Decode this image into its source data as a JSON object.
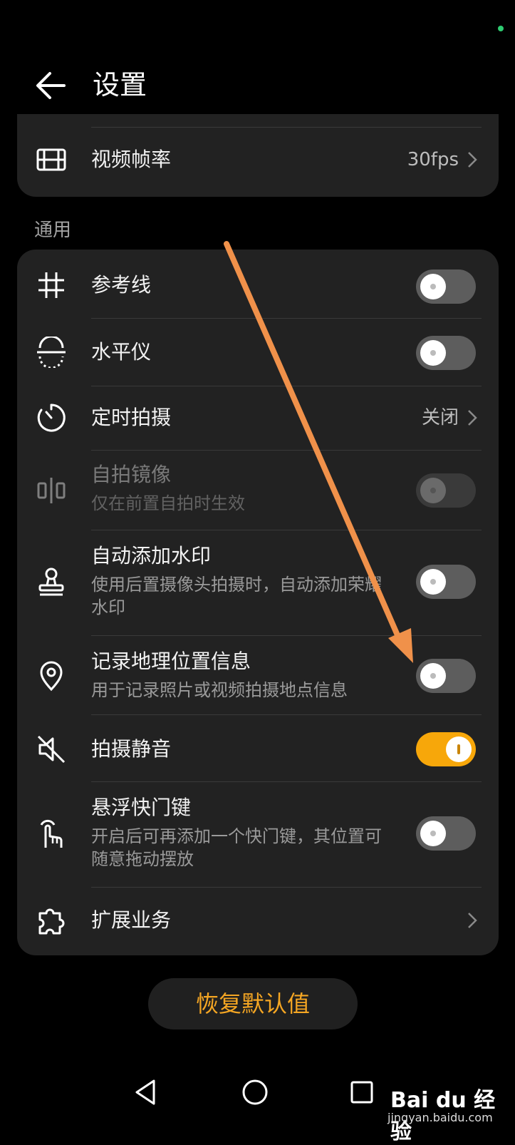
{
  "header": {
    "title": "设置"
  },
  "top_card": {
    "video_fps": {
      "label": "视频帧率",
      "value": "30fps"
    }
  },
  "section": {
    "label": "通用"
  },
  "general": {
    "grid": {
      "label": "参考线",
      "on": false
    },
    "level": {
      "label": "水平仪",
      "on": false
    },
    "timer": {
      "label": "定时拍摄",
      "value": "关闭"
    },
    "mirror": {
      "label": "自拍镜像",
      "sub": "仅在前置自拍时生效",
      "on": false,
      "enabled": false
    },
    "watermark": {
      "label": "自动添加水印",
      "sub": "使用后置摄像头拍摄时，自动添加荣耀水印",
      "on": false
    },
    "location": {
      "label": "记录地理位置信息",
      "sub": "用于记录照片或视频拍摄地点信息",
      "on": false
    },
    "mute": {
      "label": "拍摄静音",
      "on": true
    },
    "float_shutter": {
      "label": "悬浮快门键",
      "sub": "开启后可再添加一个快门键，其位置可随意拖动摆放",
      "on": false
    },
    "extensions": {
      "label": "扩展业务"
    }
  },
  "restore": {
    "label": "恢复默认值"
  },
  "colors": {
    "accent": "#F7A70A",
    "background": "#000000",
    "card": "#222222",
    "annotation_arrow": "#F0914A"
  },
  "watermark_logo": {
    "brand": "Bai du 经验",
    "url": "jingyan.baidu.com"
  }
}
